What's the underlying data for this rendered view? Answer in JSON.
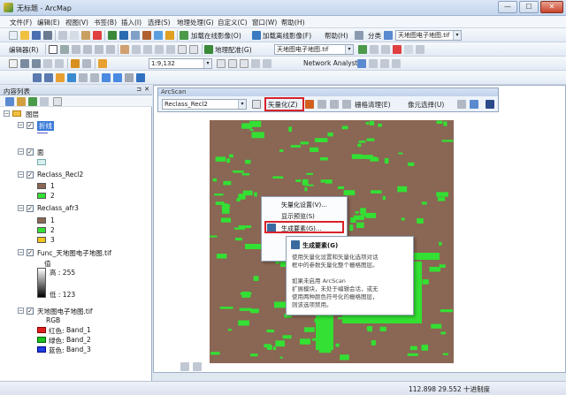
{
  "window": {
    "title": "无标题 - ArcMap",
    "min_glyph": "—",
    "max_glyph": "☐",
    "close_glyph": "✕"
  },
  "menubar": [
    "文件(F)",
    "编辑(E)",
    "视图(V)",
    "书签(B)",
    "插入(I)",
    "选择(S)",
    "地理处理(G)",
    "自定义(C)",
    "窗口(W)",
    "帮助(H)"
  ],
  "toolbar1": {
    "online_imagery": "加载在线影像(O)",
    "offline_imagery": "加载离线影像(F)",
    "help": "帮助(H)",
    "classify": "分类",
    "layer_combo": "天地图电子地图.tif"
  },
  "toolbar2": {
    "editor": "编辑器(R)",
    "georef": "地理配准(G)",
    "georef_combo": "天地图电子地图.tif"
  },
  "toolbar3": {
    "scale": "1:9,132",
    "network_analyst": "Network Analyst"
  },
  "toc": {
    "title": "内容列表",
    "root": "图层",
    "layers": [
      {
        "name": "折线"
      },
      {
        "name": "面"
      },
      {
        "name": "Reclass_Recl2",
        "classes": [
          "1",
          "2"
        ]
      },
      {
        "name": "Reclass_afr3",
        "classes": [
          "1",
          "2",
          "3"
        ]
      },
      {
        "name": "Func_天地图电子地图.tif",
        "value_label": "值",
        "high": "高 : 255",
        "low": "低 : 123"
      },
      {
        "name": "天地图电子地图.tif",
        "rgb_label": "RGB",
        "bands": [
          {
            "color": "红色:",
            "band": "Band_1"
          },
          {
            "color": "绿色:",
            "band": "Band_2"
          },
          {
            "color": "蓝色:",
            "band": "Band_3"
          }
        ]
      }
    ]
  },
  "arcscan": {
    "title": "ArcScan",
    "raster_combo": "Reclass_Recl2",
    "vectorization_menu": "矢量化(Z)",
    "raster_cleanup": "栅格清理(E)",
    "cell_selection": "像元选择(U)"
  },
  "vectorization_dropdown": {
    "items": [
      "矢量化设置(V)...",
      "显示预览(S)",
      "生成要素(G)..."
    ]
  },
  "tooltip": {
    "title": "生成要素(G)",
    "lines": [
      "使用矢量化设置和矢量化选项对话",
      "框中的参数矢量化整个栅格图层。",
      "",
      "如果未启用 ArcScan",
      "扩展模块，未处于编辑会话，或无",
      "使用两种颜色符号化的栅格图层，",
      "则该选项禁用。"
    ]
  },
  "status": {
    "coords": "112.898  29.552 十进制度"
  },
  "colors": {
    "raster_bg": "#8a6654",
    "raster_fg": "#33e033",
    "highlight": "#d8232a",
    "class1": "#8a6654",
    "class2": "#33e033",
    "class3": "#f0c419"
  }
}
